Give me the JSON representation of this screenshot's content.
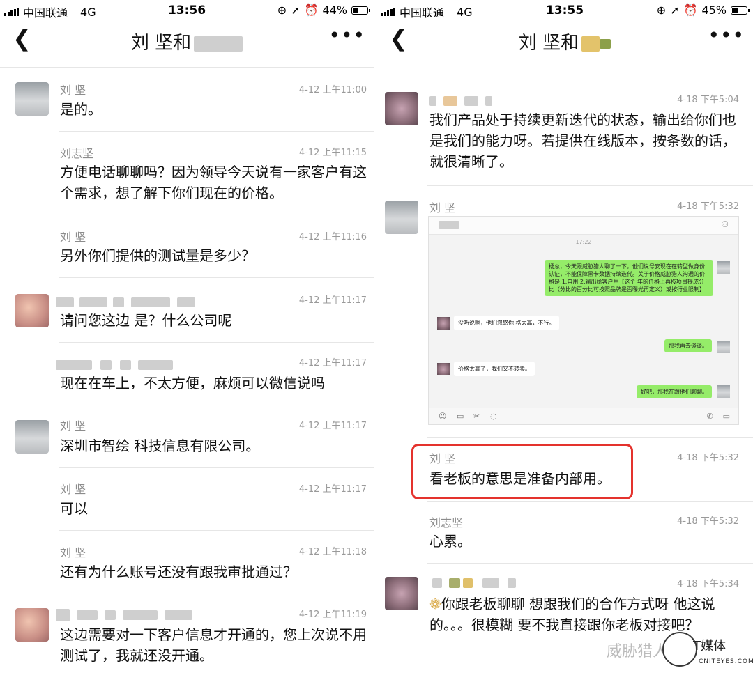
{
  "left": {
    "status": {
      "carrier": "中国联通",
      "network": "4G",
      "time": "13:56",
      "battery": "44%",
      "battery_level": 0.44
    },
    "title": "刘 坚和",
    "messages": [
      {
        "sender": "刘 坚",
        "time": "4-12 上午11:00",
        "text": "是的。"
      },
      {
        "sender": "刘志坚",
        "time": "4-12 上午11:15",
        "text": "方便电话聊聊吗？因为领导今天说有一家客户有这个需求，想了解下你们现在的价格。"
      },
      {
        "sender": "刘 坚",
        "time": "4-12 上午11:16",
        "text": "另外你们提供的测试量是多少？"
      },
      {
        "sender": "",
        "time": "4-12 上午11:17",
        "text": "请问您这边 是？什么公司呢"
      },
      {
        "sender": "",
        "time": "4-12 上午11:17",
        "text": "现在在车上，不太方便，麻烦可以微信说吗"
      },
      {
        "sender": "刘 坚",
        "time": "4-12 上午11:17",
        "text": "深圳市智绘  科技信息有限公司。"
      },
      {
        "sender": "刘 坚",
        "time": "4-12 上午11:17",
        "text": "可以"
      },
      {
        "sender": "刘 坚",
        "time": "4-12 上午11:18",
        "text": "还有为什么账号还没有跟我审批通过？"
      },
      {
        "sender": "",
        "time": "4-12 上午11:19",
        "text": "这边需要对一下客户信息才开通的，您上次说不用测试了，我就还没开通。"
      }
    ]
  },
  "right": {
    "status": {
      "carrier": "中国联通",
      "network": "4G",
      "time": "13:55",
      "battery": "45%",
      "battery_level": 0.45
    },
    "title": "刘 坚和",
    "messages": [
      {
        "sender": "",
        "time": "4-18 下午5:04",
        "text": "我们产品处于持续更新迭代的状态，输出给你们也是我们的能力呀。若提供在线版本，按条数的话，就很清晰了。"
      },
      {
        "sender": "刘 坚",
        "time": "4-18 下午5:32",
        "text": ""
      },
      {
        "sender": "刘 坚",
        "time": "4-18 下午5:32",
        "text": "看老板的意思是准备内部用。"
      },
      {
        "sender": "刘志坚",
        "time": "4-18 下午5:32",
        "text": "心累。"
      },
      {
        "sender": "",
        "time": "4-18 下午5:34",
        "text": "你跟老板聊聊 想跟我们的合作方式呀 他这说的。。。很模糊 要不我直接跟你老板对接吧？"
      }
    ],
    "embedded": {
      "time": "17:22",
      "msg1": "杨总，今天跟威胁猎人聊了一下，他们说号安现在在转型做身份认证，不能保障黑卡数据持续迭代。关于价格威胁猎人沟通的价格是:1.自用 2.输出给客户用【这个 年的价格上再按项目提成分比（分比的百分比可按照品牌是否曝光再定义）或按行业限制】",
      "msg2": "没听说啊，他们忽悠你 格太高，不行。",
      "msg3": "那我再去谈谈。",
      "msg4": "价格太高了，我们又不转卖。",
      "msg5": "好吧，那我在跟他们聊聊。"
    }
  },
  "watermark": {
    "text1": "威胁猎人",
    "text2": "T媒体",
    "text3": "CNITEYES.COM"
  }
}
